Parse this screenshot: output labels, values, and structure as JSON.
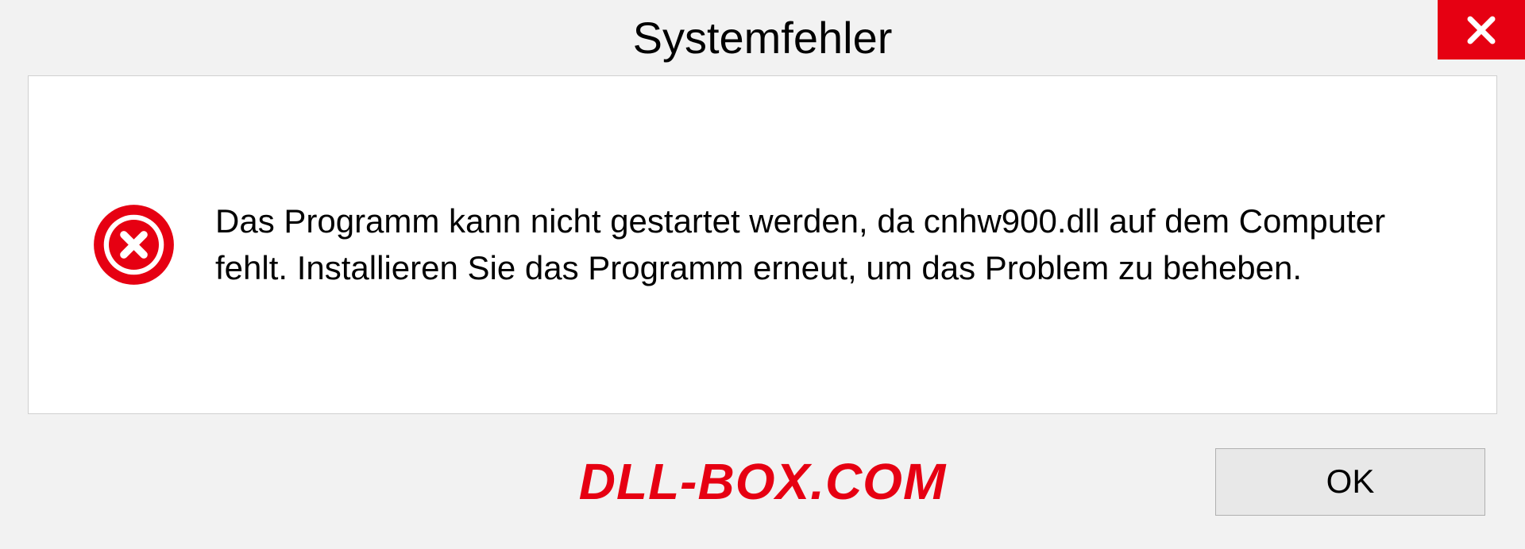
{
  "dialog": {
    "title": "Systemfehler",
    "message": "Das Programm kann nicht gestartet werden, da cnhw900.dll auf dem Computer fehlt. Installieren Sie das Programm erneut, um das Problem zu beheben.",
    "ok_label": "OK",
    "watermark": "DLL-BOX.COM"
  }
}
